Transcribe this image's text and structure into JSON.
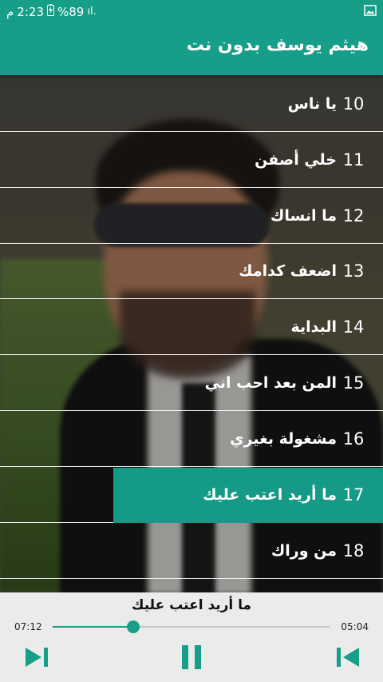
{
  "status_bar": {
    "time": "2:23",
    "period": "م",
    "battery": "%89",
    "signal": "ıl."
  },
  "header": {
    "title": "هيثم يوسف بدون نت"
  },
  "tracks": [
    {
      "number": "10",
      "title": "يا ناس"
    },
    {
      "number": "11",
      "title": "خلي أصفن"
    },
    {
      "number": "12",
      "title": "ما انساك"
    },
    {
      "number": "13",
      "title": "اضعف كدامك"
    },
    {
      "number": "14",
      "title": "البداية"
    },
    {
      "number": "15",
      "title": "المن بعد احب اني"
    },
    {
      "number": "16",
      "title": "مشغولة بغيري"
    },
    {
      "number": "17",
      "title": "ما أريد اعتب عليك"
    },
    {
      "number": "18",
      "title": "من وراك"
    }
  ],
  "active_track_index": 7,
  "player": {
    "now_playing": "ما أريد اعتب عليك",
    "elapsed": "07:12",
    "total": "05:04",
    "progress": 0.29
  },
  "colors": {
    "accent": "#169e89",
    "player_bg": "#ebebeb",
    "control_icon": "#169e89"
  },
  "icons": {
    "next": "skip-next-icon",
    "play_pause": "pause-icon",
    "previous": "skip-previous-icon",
    "status_image": "image-icon"
  }
}
